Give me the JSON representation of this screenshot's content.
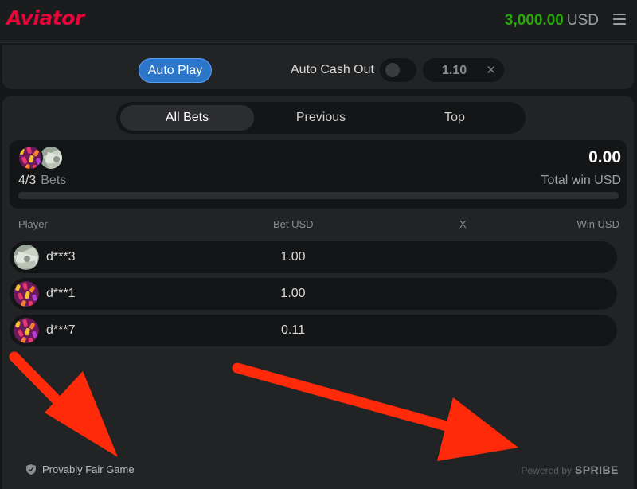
{
  "header": {
    "logo_text": "Aviator",
    "balance_amount": "3,000.00",
    "balance_currency": "USD",
    "menu_icon": "hamburger-icon"
  },
  "controls": {
    "auto_play_label": "Auto Play",
    "auto_cash_out_label": "Auto Cash Out",
    "auto_cash_out_enabled": false,
    "cash_out_value": "1.10",
    "clear_icon": "close-icon"
  },
  "tabs": [
    {
      "label": "All Bets",
      "active": true
    },
    {
      "label": "Previous",
      "active": false
    },
    {
      "label": "Top",
      "active": false
    }
  ],
  "summary": {
    "bets_count": "4/3",
    "bets_label": "Bets",
    "total_win": "0.00",
    "total_win_label": "Total win USD"
  },
  "table": {
    "columns": [
      "Player",
      "Bet USD",
      "X",
      "Win USD"
    ],
    "rows": [
      {
        "player": "d***3",
        "bet": "1.00",
        "avatar": "money-avatar"
      },
      {
        "player": "d***1",
        "bet": "1.00",
        "avatar": "candy-avatar"
      },
      {
        "player": "d***7",
        "bet": "0.11",
        "avatar": "candy-avatar"
      }
    ]
  },
  "footer": {
    "fair_label": "Provably Fair Game",
    "fair_icon": "shield-check-icon",
    "powered_label": "Powered by",
    "powered_brand": "SPRIBE"
  },
  "colors": {
    "brand_red": "#e50539",
    "balance_green": "#28a909",
    "autoplay_blue": "#2c76c9",
    "annotation_arrow": "#ff2a0a"
  }
}
